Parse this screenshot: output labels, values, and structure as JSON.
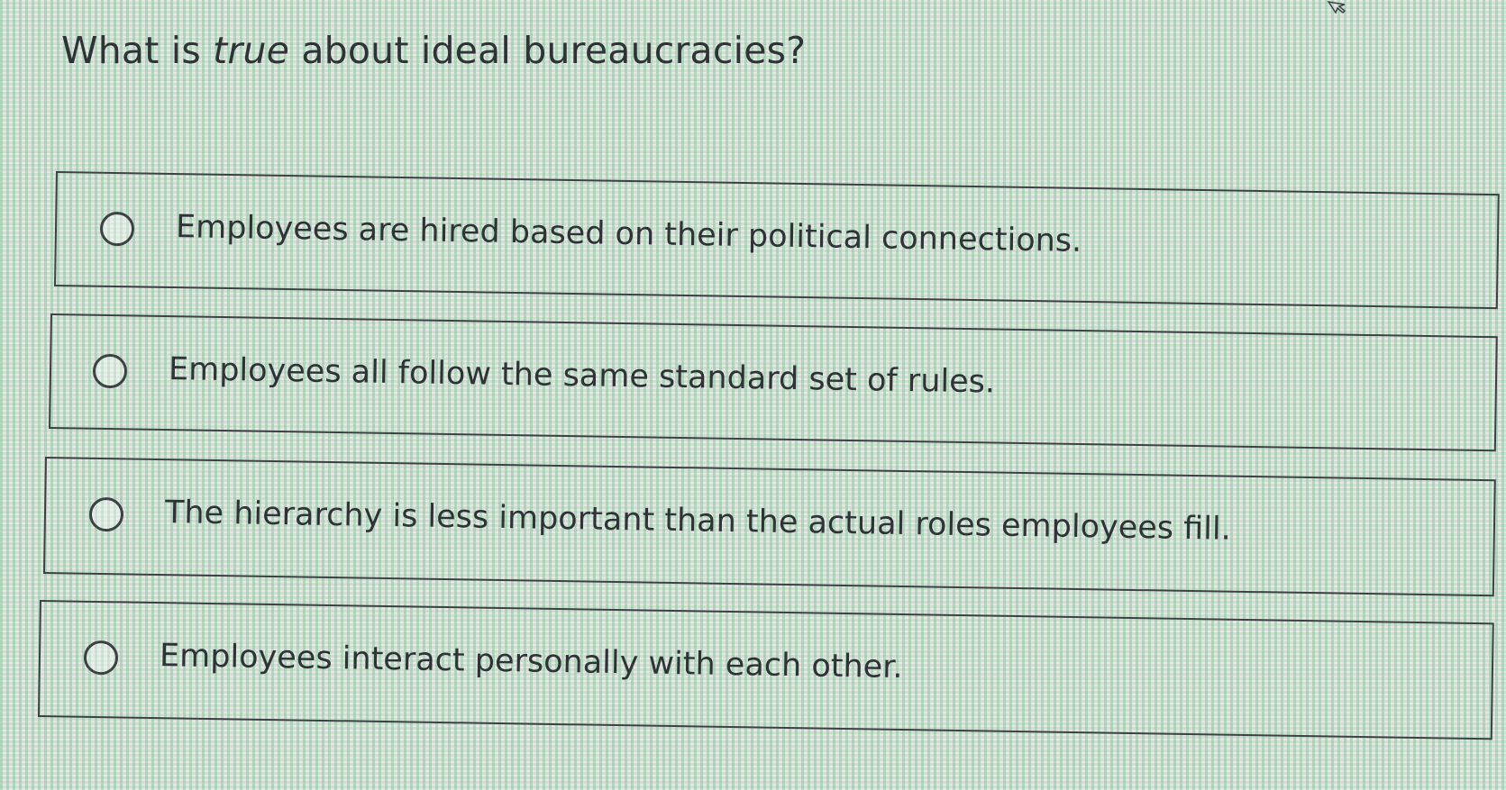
{
  "question": {
    "prefix": "What is ",
    "emphasis": "true",
    "suffix": " about ideal bureaucracies?"
  },
  "options": [
    {
      "label": "Employees are hired based on their political connections.",
      "selected": false
    },
    {
      "label": "Employees all follow the same standard set of rules.",
      "selected": false
    },
    {
      "label": "The hierarchy is less important than the actual roles employees fill.",
      "selected": false
    },
    {
      "label": "Employees interact personally with each other.",
      "selected": false
    }
  ],
  "icons": {
    "radio": "radio-unselected-icon",
    "cursor": "pointer-cursor-icon"
  },
  "colors": {
    "text": "#2f3337",
    "border": "#3d4145"
  }
}
